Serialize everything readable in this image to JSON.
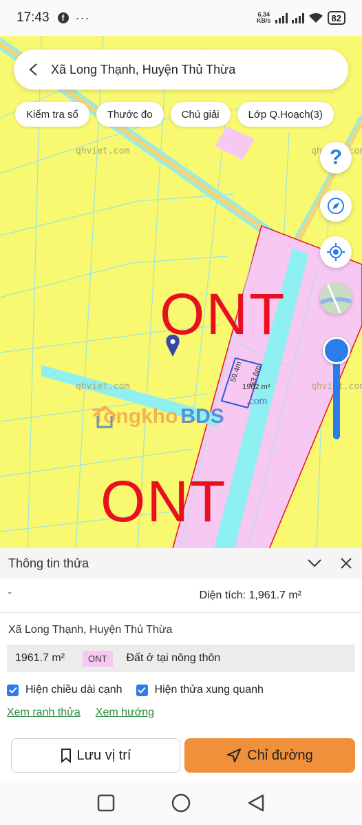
{
  "status": {
    "time": "17:43",
    "dots": "···",
    "speed_value": "6,34",
    "speed_unit": "KB/s",
    "battery": "82"
  },
  "search": {
    "title": "Xã Long Thạnh, Huyện Thủ Thừa"
  },
  "chips": [
    {
      "label": "Kiểm tra sổ"
    },
    {
      "label": "Thước đo"
    },
    {
      "label": "Chú giải"
    },
    {
      "label": "Lớp Q.Hoạch(3)"
    }
  ],
  "map": {
    "watermarks": [
      "qhviet.com",
      "qhviet.com",
      "qhviet.com",
      "qhviet.com"
    ],
    "zone_labels": [
      "ONT",
      "ONT"
    ],
    "logo_text_1": "Tongkho",
    "logo_text_2": "BDS",
    "logo_suffix": ".com",
    "parcel_area_label": "1962 m²",
    "edge_label_1": "59.4m",
    "edge_label_2": "53.6m",
    "colors": {
      "base_land": "#f9f871",
      "residential": "#f7c8f2",
      "canal": "#8ef0f0",
      "boundary": "#e8101e",
      "accent": "#2b7de9"
    }
  },
  "sheet": {
    "title": "Thông tin thửa",
    "left_mark": "ˇ",
    "area_label": "Diện tích: 1,961.7 m²",
    "address": "Xã Long Thạnh, Huyện Thủ Thừa",
    "land_area": "1961.7 m²",
    "land_code": "ONT",
    "land_desc": "Đất ở tại nông thôn",
    "check_edges": "Hiện chiều dài cạnh",
    "check_neighbors": "Hiện thửa xung quanh",
    "link_boundary": "Xem ranh thửa",
    "link_direction": "Xem hướng",
    "save_label": "Lưu vị trí",
    "directions_label": "Chỉ đường"
  }
}
